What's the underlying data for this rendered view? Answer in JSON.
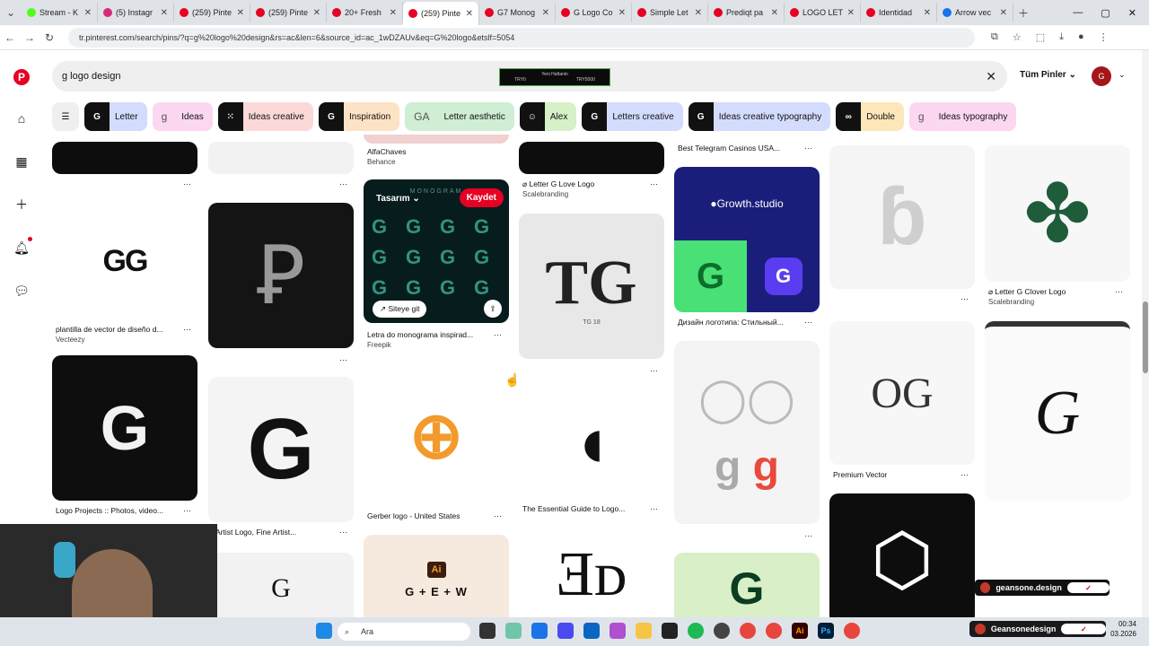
{
  "browser": {
    "tabs": [
      {
        "label": "Stream - K",
        "color": "#53fc18"
      },
      {
        "label": "(5) Instagr",
        "color": "#d62976"
      },
      {
        "label": "(259) Pinte",
        "color": "#e60023"
      },
      {
        "label": "(259) Pinte",
        "color": "#e60023"
      },
      {
        "label": "20+ Fresh",
        "color": "#e60023"
      },
      {
        "label": "(259) Pinte",
        "color": "#e60023",
        "active": true
      },
      {
        "label": "G7 Monog",
        "color": "#e60023"
      },
      {
        "label": "G Logo Co",
        "color": "#e60023"
      },
      {
        "label": "Simple Let",
        "color": "#e60023"
      },
      {
        "label": "Prediqt pa",
        "color": "#e60023"
      },
      {
        "label": "LOGO LET",
        "color": "#e60023"
      },
      {
        "label": "Identidad",
        "color": "#e60023"
      },
      {
        "label": "Arrow vec",
        "color": "#1a73e8"
      }
    ],
    "url": "tr.pinterest.com/search/pins/?q=g%20logo%20design&rs=ac&len=6&source_id=ac_1wDZAUv&eq=G%20logo&etslf=5054"
  },
  "header": {
    "search_value": "g logo design",
    "filter_label": "Tüm Pinler",
    "ad": {
      "line1": "Yeni Haftanin",
      "line2": "TRY0",
      "line3": "TRY5000"
    }
  },
  "chips": [
    {
      "label": "Letter",
      "bg": "#d4dcfd",
      "thumb": "G"
    },
    {
      "label": "Ideas",
      "bg": "#fbd7f0",
      "thumb": "g",
      "plain": true
    },
    {
      "label": "Ideas creative",
      "bg": "#fbd9d9",
      "thumb": "⁙"
    },
    {
      "label": "Inspiration",
      "bg": "#fde3c5",
      "thumb": "G"
    },
    {
      "label": "Letter aesthetic",
      "bg": "#cfeed3",
      "thumb": "GA",
      "plain": true
    },
    {
      "label": "Alex",
      "bg": "#d6f0c8",
      "thumb": "☺"
    },
    {
      "label": "Letters creative",
      "bg": "#d4dcfd",
      "thumb": "G"
    },
    {
      "label": "Ideas creative typography",
      "bg": "#d4dcfd",
      "thumb": "G"
    },
    {
      "label": "Double",
      "bg": "#fde6ba",
      "thumb": "∞"
    },
    {
      "label": "Ideas typography",
      "bg": "#fbd7f0",
      "thumb": "g",
      "plain": true
    }
  ],
  "pins": {
    "c0_cap1": "plantilla de vector de diseño d...",
    "c0_sub1": "Vecteezy",
    "c0_cap2": "Logo Projects :: Photos, video...",
    "c1_cap1": "Artist Logo, Fine Artist...",
    "c2_cap0": "AlfaChaves",
    "c2_sub0": "Behance",
    "c2_board": "Tasarım",
    "c2_save": "Kaydet",
    "c2_visit": "Siteye git",
    "c2_cap1": "Letra do monograma inspirad...",
    "c2_sub1": "Freepik",
    "c2_cap2": "Gerber logo - United States",
    "c2_ai_text": "G + E + W",
    "c2_ai_badge": "Ai",
    "c2_mono_label": "MONOGRAM",
    "c3_cap0": "⌀ Letter G Love Logo",
    "c3_sub0": "Scalebranding",
    "c3_tg": "TG 18",
    "c3_cap2": "The Essential Guide to Logo...",
    "c4_cap0": "Best Telegram Casinos USA...",
    "c4_growth": "Growth.studio",
    "c4_cap1": "Дизайн логотипа: Стильный...",
    "c5_cap1": "Premium Vector",
    "c6_cap0": "⌀ Letter G Clover Logo",
    "c6_sub0": "Scalebranding"
  },
  "overlays": {
    "tag1": "geansone.design",
    "tag2": "Geansonedesign"
  },
  "taskbar": {
    "search": "Ara",
    "time": "00:34",
    "date": "03.2026"
  }
}
